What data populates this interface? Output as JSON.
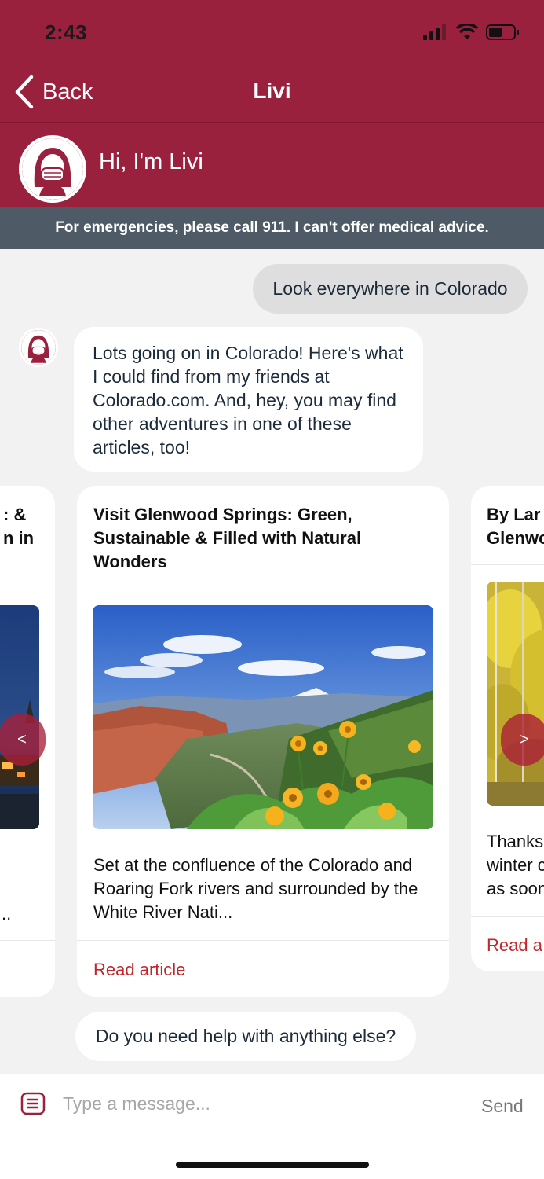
{
  "status_bar": {
    "time": "2:43"
  },
  "nav": {
    "back_label": "Back",
    "title": "Livi"
  },
  "assistant": {
    "greeting": "Hi, I'm Livi"
  },
  "disclaimer": "For emergencies, please call 911. I can't offer medical advice.",
  "messages": {
    "user": "Look everywhere in Colorado",
    "bot_intro": "Lots going on in Colorado! Here's what I could find from my friends at Colorado.com. And, hey, you may find other adventures in one of these articles, too!",
    "bot_followup": "Do you need help with anything else?"
  },
  "carousel": {
    "prev_label": "<",
    "next_label": ">",
    "cards": [
      {
        "title_partial": ": &\nn in",
        "desc_partial": ".."
      },
      {
        "title": "Visit Glenwood Springs: Green, Sustainable & Filled with Natural Wonders",
        "description": "Set at the confluence of the Colorado and Roaring Fork rivers and surrounded by the White River Nati...",
        "link": "Read article"
      },
      {
        "title_partial": "By Lar\nGlenwo",
        "desc_partial": "Thanks\nwinter c\nas soon",
        "link_partial": "Read a"
      }
    ]
  },
  "input": {
    "placeholder": "Type a message...",
    "send_label": "Send"
  },
  "colors": {
    "brand": "#9a213d",
    "disclaimer_bg": "#4e5b66",
    "link": "#c0272d"
  }
}
